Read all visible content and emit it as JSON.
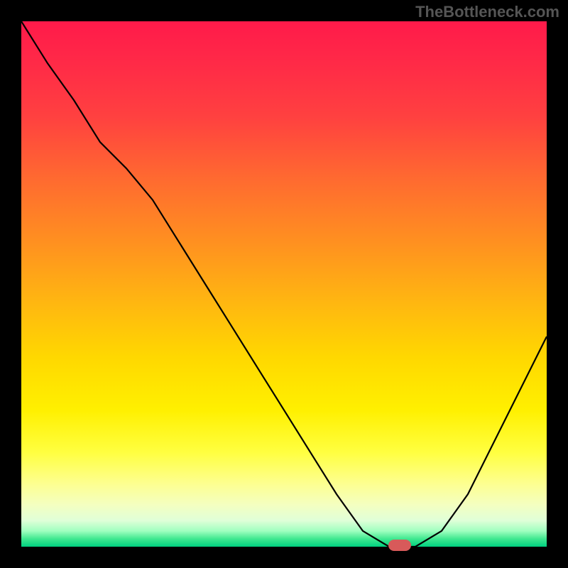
{
  "watermark": "TheBottleneck.com",
  "chart_data": {
    "type": "line",
    "title": "",
    "xlabel": "",
    "ylabel": "",
    "x": [
      0.0,
      0.05,
      0.1,
      0.15,
      0.2,
      0.25,
      0.3,
      0.35,
      0.4,
      0.45,
      0.5,
      0.55,
      0.6,
      0.65,
      0.7,
      0.75,
      0.8,
      0.85,
      0.9,
      0.95,
      1.0
    ],
    "values": [
      1.0,
      0.92,
      0.85,
      0.77,
      0.72,
      0.66,
      0.58,
      0.5,
      0.42,
      0.34,
      0.26,
      0.18,
      0.1,
      0.03,
      0.0,
      0.0,
      0.03,
      0.1,
      0.2,
      0.3,
      0.4
    ],
    "xlim": [
      0,
      1
    ],
    "ylim": [
      0,
      1
    ],
    "marker_x": 0.72,
    "marker_y": 0.0,
    "gradient": "red-yellow-green vertical"
  }
}
